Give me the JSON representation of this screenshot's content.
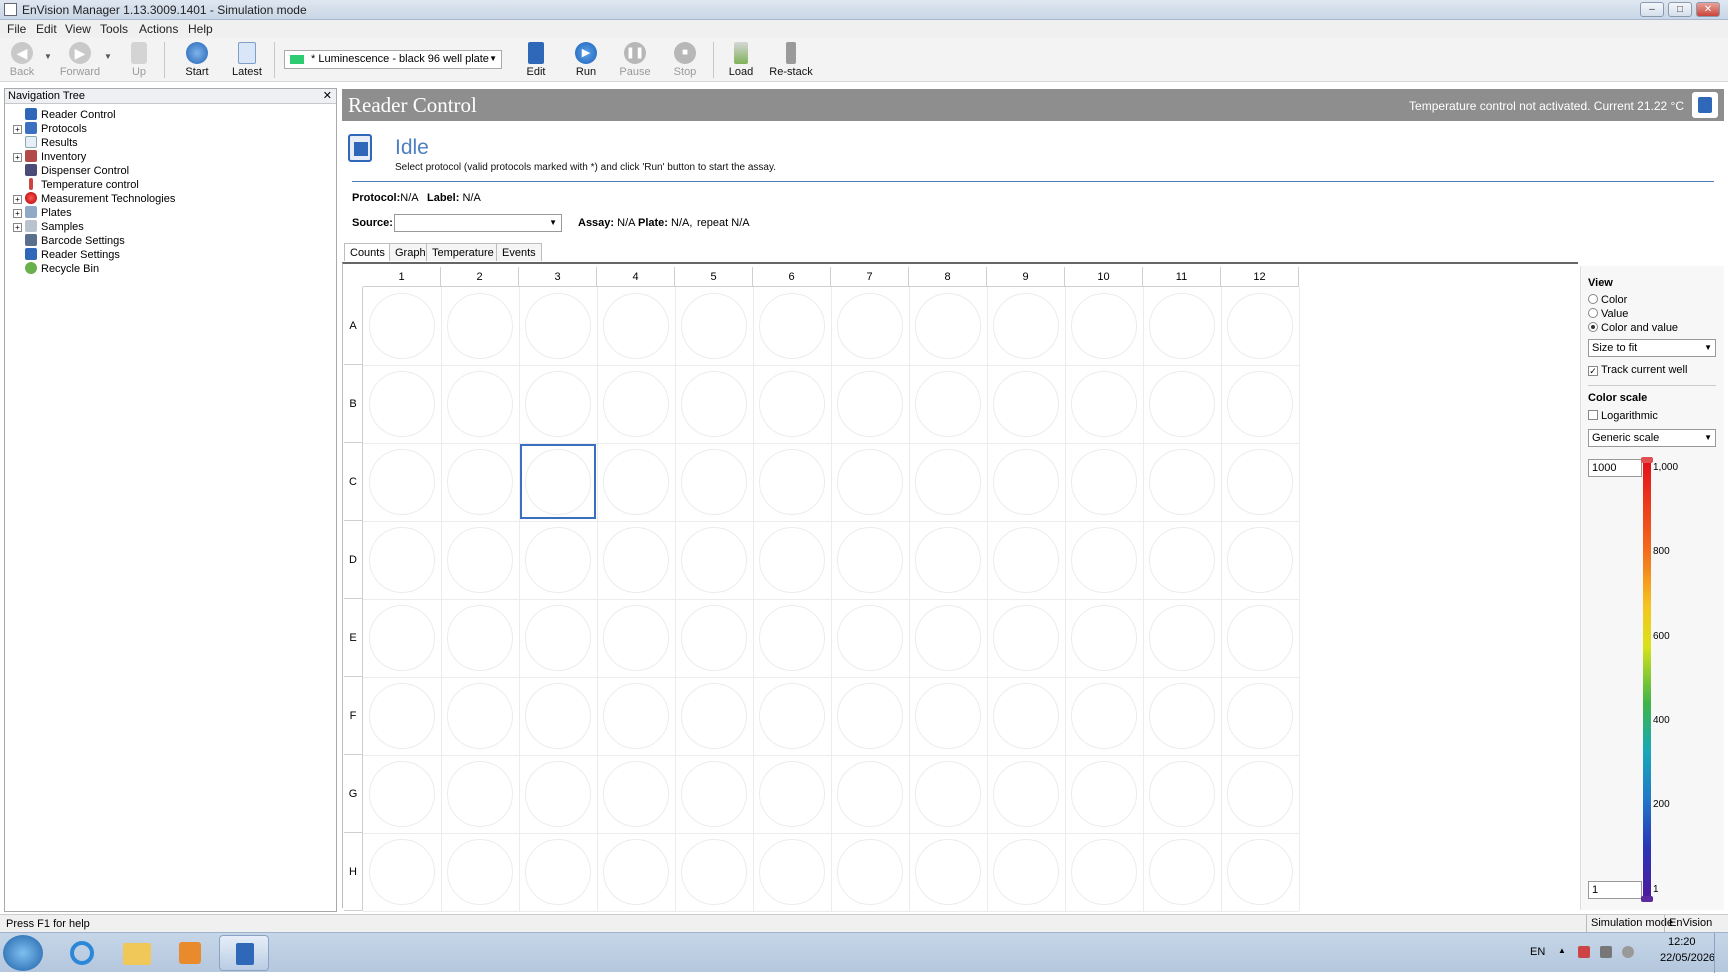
{
  "window": {
    "title": "EnVision Manager 1.13.3009.1401 - Simulation mode",
    "min": "–",
    "max": "□",
    "close": "✕"
  },
  "menu": [
    "File",
    "Edit",
    "View",
    "Tools",
    "Actions",
    "Help"
  ],
  "toolbar": {
    "back": "Back",
    "forward": "Forward",
    "up": "Up",
    "start": "Start",
    "latest": "Latest",
    "protocol": "* Luminescence - black 96 well plate",
    "edit": "Edit",
    "run": "Run",
    "pause": "Pause",
    "stop": "Stop",
    "load": "Load",
    "restack": "Re-stack"
  },
  "nav": {
    "title": "Navigation Tree",
    "close": "✕",
    "items": [
      "Reader Control",
      "Protocols",
      "Results",
      "Inventory",
      "Dispenser Control",
      "Temperature control",
      "Measurement Technologies",
      "Plates",
      "Samples",
      "Barcode Settings",
      "Reader Settings",
      "Recycle Bin"
    ]
  },
  "header": {
    "title": "Reader Control",
    "temperature": "Temperature control not activated. Current 21.22 °C"
  },
  "status": {
    "state": "Idle",
    "hint": "Select protocol (valid protocols marked with *) and click 'Run' button to start the assay."
  },
  "info": {
    "protocol_label": "Protocol:",
    "protocol_value": "N/A",
    "label_label": "Label:",
    "label_value": "N/A",
    "source_label": "Source:",
    "assay_label": "Assay:",
    "assay_value": "N/A",
    "plate_label": "Plate:",
    "plate_value": "N/A,",
    "repeat_value": "repeat N/A"
  },
  "tabs": [
    "Counts",
    "Graph",
    "Temperature",
    "Events"
  ],
  "plate": {
    "columns": [
      "1",
      "2",
      "3",
      "4",
      "5",
      "6",
      "7",
      "8",
      "9",
      "10",
      "11",
      "12"
    ],
    "rows": [
      "A",
      "B",
      "C",
      "D",
      "E",
      "F",
      "G",
      "H"
    ],
    "current_well": "C3"
  },
  "view": {
    "title": "View",
    "opt_color": "Color",
    "opt_value": "Value",
    "opt_color_value": "Color and value",
    "selected": "Color and value",
    "size": "Size to fit",
    "track": "Track current well",
    "track_checked": true
  },
  "colorscale": {
    "title": "Color scale",
    "log": "Logarithmic",
    "log_checked": false,
    "scale": "Generic scale",
    "max": "1000",
    "min": "1",
    "ticks": [
      "1,000",
      "800",
      "600",
      "400",
      "200",
      "1"
    ]
  },
  "statusbar": {
    "help": "Press F1 for help",
    "mode": "Simulation mode",
    "app": "EnVision"
  },
  "taskbar": {
    "lang": "EN",
    "time": "12:20",
    "date": "22/05/2026"
  },
  "colors": {
    "accent": "#4e7fc0",
    "header": "#8e8e8e",
    "current_well": "#3a6fc2"
  }
}
